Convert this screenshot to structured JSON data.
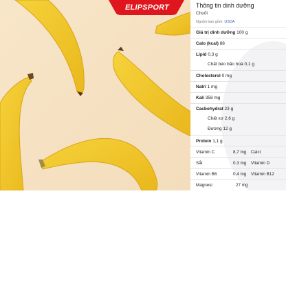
{
  "logo": {
    "text": "ELIPSPORT",
    "color": "#e0161e"
  },
  "nutrition": {
    "title": "Thông tin dinh dưỡng",
    "subtitle": "Chuối",
    "source_label": "Nguồn bao gồm:",
    "source_link": "USDA",
    "rows": [
      {
        "label": "Giá trị dinh dưỡng",
        "value": "100 g"
      },
      {
        "label": "Calo (kcal)",
        "value": "88"
      },
      {
        "label": "Lipid",
        "value": "0,3 g"
      },
      {
        "label": "Chất béo bão hoà",
        "value": "0,1 g"
      },
      {
        "label": "Cholesterol",
        "value": "0 mg"
      },
      {
        "label": "Natri",
        "value": "1 mg"
      },
      {
        "label": "Kali",
        "value": "358 mg"
      },
      {
        "label": "Cacbohydrat",
        "value": "23 g"
      },
      {
        "label": "Chất xơ",
        "value": "2,6 g"
      },
      {
        "label": "Đường",
        "value": "12 g"
      },
      {
        "label": "Protein",
        "value": "1,1 g"
      }
    ],
    "vitamins": [
      {
        "name": "Vitamin C",
        "value": "8,7 mg",
        "name2": "Calci"
      },
      {
        "name": "Sắt",
        "value": "0,3 mg",
        "name2": "Vitamin D"
      },
      {
        "name": "Vitamin B6",
        "value": "0,4 mg",
        "name2": "Vitamin B12"
      },
      {
        "name": "Magnesi",
        "value": "27 mg",
        "name2": ""
      }
    ]
  }
}
